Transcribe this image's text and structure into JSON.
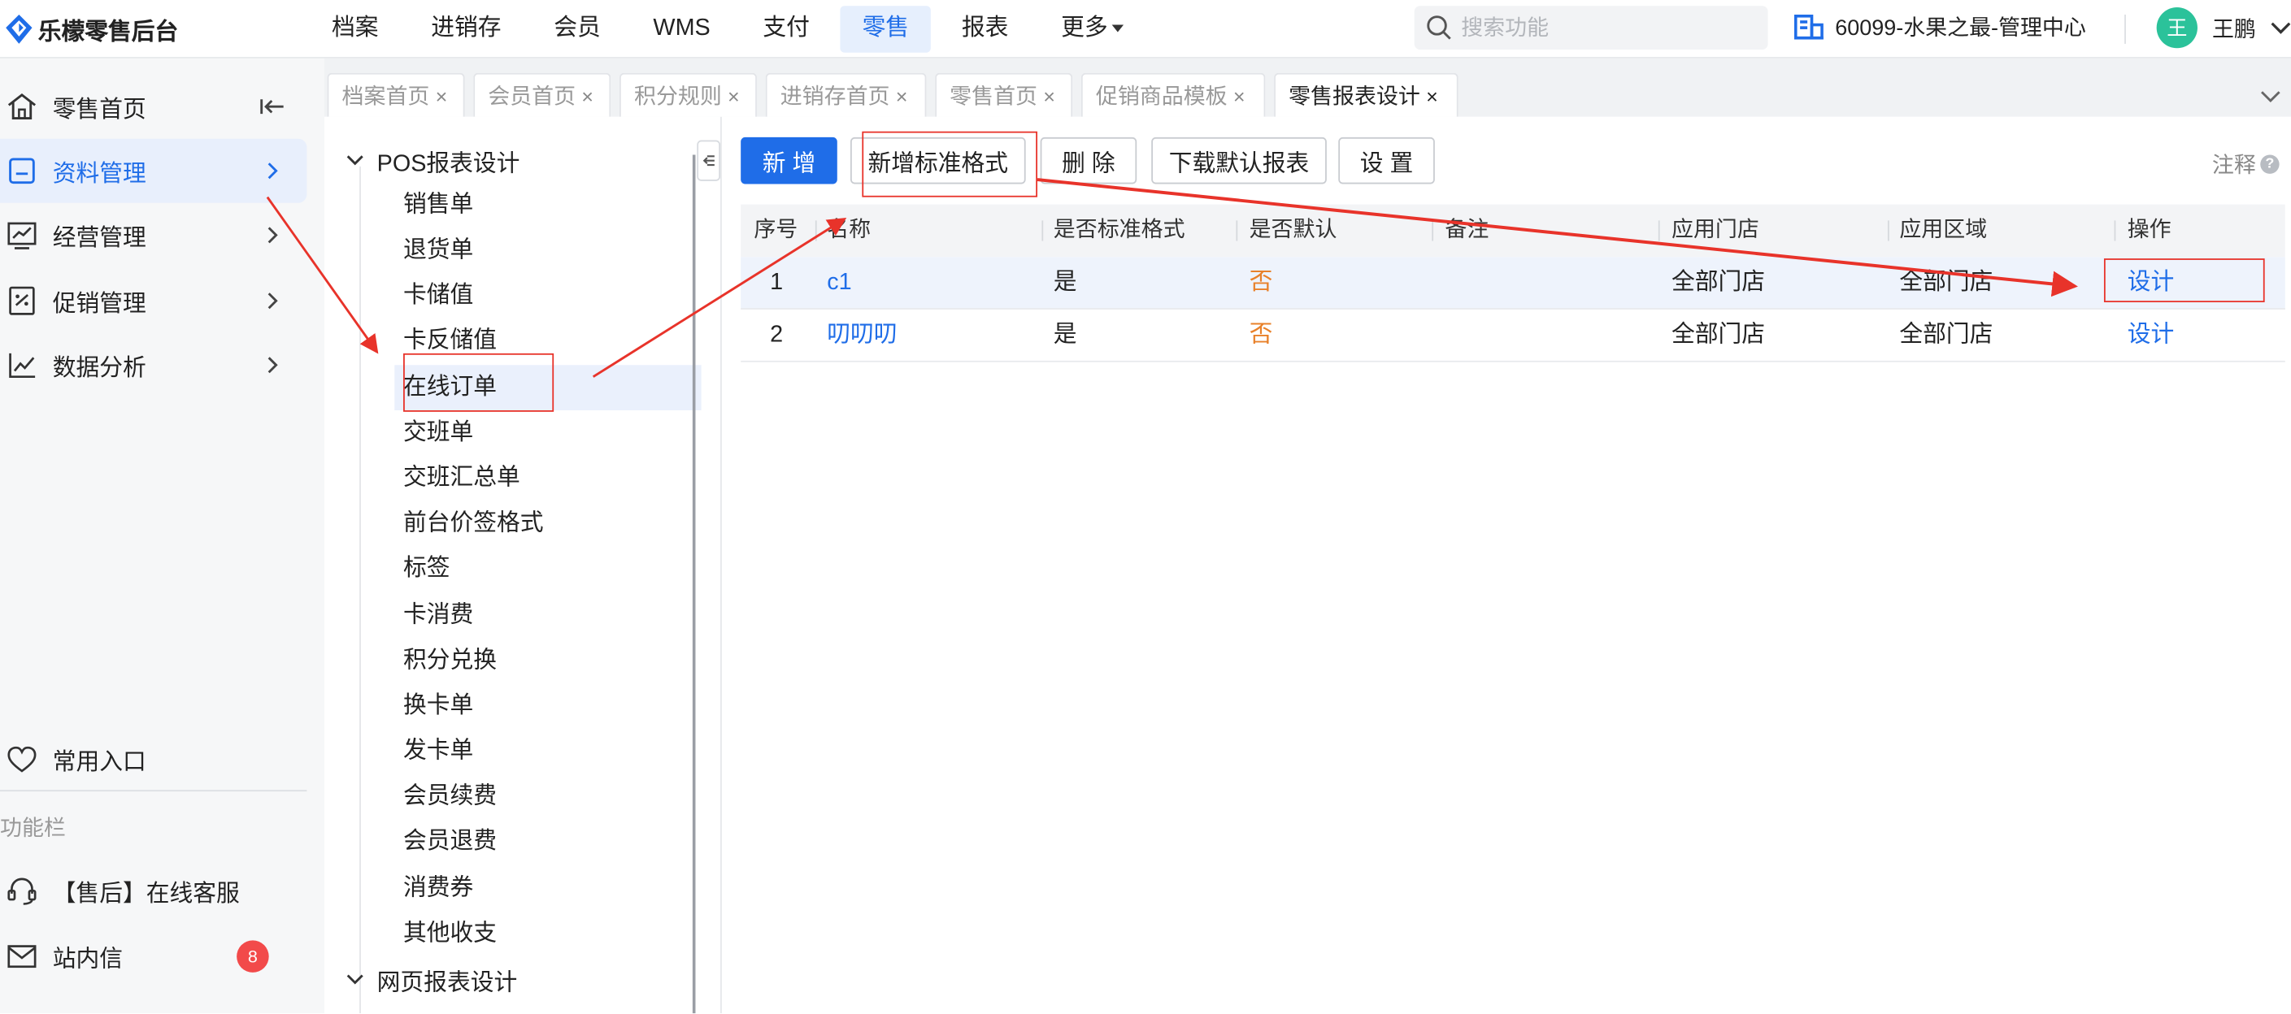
{
  "app": {
    "title": "乐檬零售后台"
  },
  "nav": {
    "items": [
      "档案",
      "进销存",
      "会员",
      "WMS",
      "支付",
      "零售",
      "报表"
    ],
    "active": "零售",
    "more": "更多"
  },
  "search": {
    "placeholder": "搜索功能"
  },
  "store": {
    "name": "60099-水果之最-管理中心"
  },
  "user": {
    "name": "王鹏",
    "avatar_char": "王"
  },
  "sidebar": {
    "items": [
      {
        "label": "零售首页",
        "icon": "home-icon"
      },
      {
        "label": "资料管理",
        "icon": "document-icon"
      },
      {
        "label": "经营管理",
        "icon": "chart-icon"
      },
      {
        "label": "促销管理",
        "icon": "coupon-icon"
      },
      {
        "label": "数据分析",
        "icon": "trend-icon"
      }
    ],
    "favorites": "常用入口",
    "section_label": "功能栏",
    "support": "【售后】在线客服",
    "inbox": "站内信",
    "inbox_count": "8"
  },
  "tabs": [
    {
      "label": "档案首页"
    },
    {
      "label": "会员首页"
    },
    {
      "label": "积分规则"
    },
    {
      "label": "进销存首页"
    },
    {
      "label": "零售首页"
    },
    {
      "label": "促销商品模板"
    },
    {
      "label": "零售报表设计"
    }
  ],
  "close_glyph": "×",
  "tree": {
    "group1": "POS报表设计",
    "leaves": [
      "销售单",
      "退货单",
      "卡储值",
      "卡反储值",
      "在线订单",
      "交班单",
      "交班汇总单",
      "前台价签格式",
      "标签",
      "卡消费",
      "积分兑换",
      "换卡单",
      "发卡单",
      "会员续费",
      "会员退费",
      "消费券",
      "其他收支"
    ],
    "group2": "网页报表设计"
  },
  "toolbar": {
    "add": "新 增",
    "add_standard": "新增标准格式",
    "delete": "删 除",
    "download": "下载默认报表",
    "settings": "设 置",
    "note": "注释"
  },
  "table": {
    "headers": [
      "序号",
      "名称",
      "是否标准格式",
      "是否默认",
      "备注",
      "应用门店",
      "应用区域",
      "操作"
    ],
    "rows": [
      {
        "no": "1",
        "name": "c1",
        "standard": "是",
        "default": "否",
        "remark": "",
        "store": "全部门店",
        "area": "全部门店",
        "action": "设计"
      },
      {
        "no": "2",
        "name": "叨叨叨",
        "standard": "是",
        "default": "否",
        "remark": "",
        "store": "全部门店",
        "area": "全部门店",
        "action": "设计"
      }
    ]
  },
  "colors": {
    "accent": "#1f6de8",
    "orange": "#e8812a",
    "annotation": "#e8332a"
  }
}
